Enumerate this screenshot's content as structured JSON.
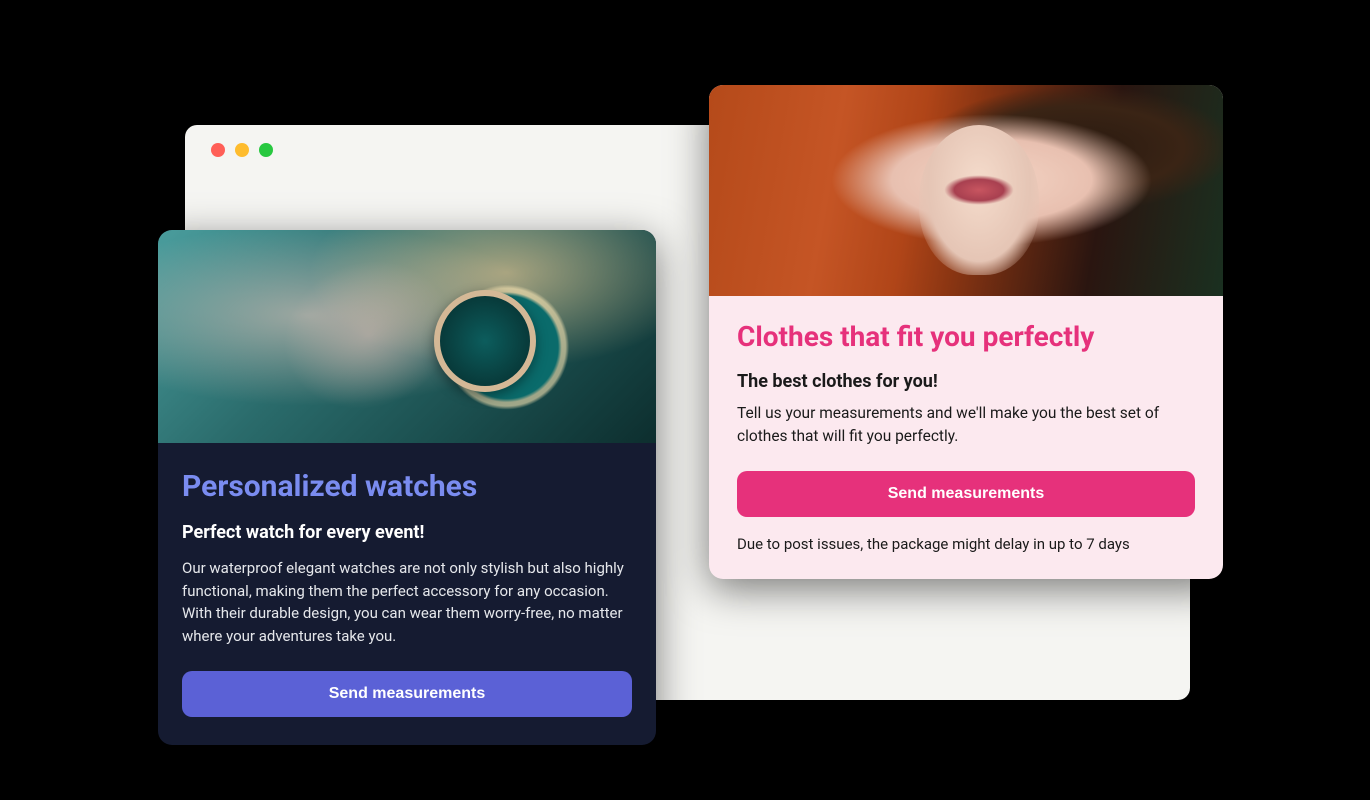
{
  "cards": {
    "watches": {
      "title": "Personalized watches",
      "subtitle": "Perfect watch for every event!",
      "description": "Our waterproof elegant watches are not only stylish but also highly functional, making them the perfect accessory for any occasion. With their durable design, you can wear them worry-free, no matter where your adventures take you.",
      "button_label": "Send measurements",
      "colors": {
        "title": "#7a8cf0",
        "button": "#5b61d6",
        "bg": "#151b31"
      }
    },
    "clothes": {
      "title": "Clothes that fit you perfectly",
      "subtitle": "The best clothes for you!",
      "description": "Tell us your measurements and we'll make you the best set of clothes that will fit you perfectly.",
      "button_label": "Send measurements",
      "note": "Due to post issues, the package might delay in up to 7 days",
      "colors": {
        "title": "#e6317b",
        "button": "#e6317b",
        "bg": "#fce9ef"
      }
    }
  }
}
